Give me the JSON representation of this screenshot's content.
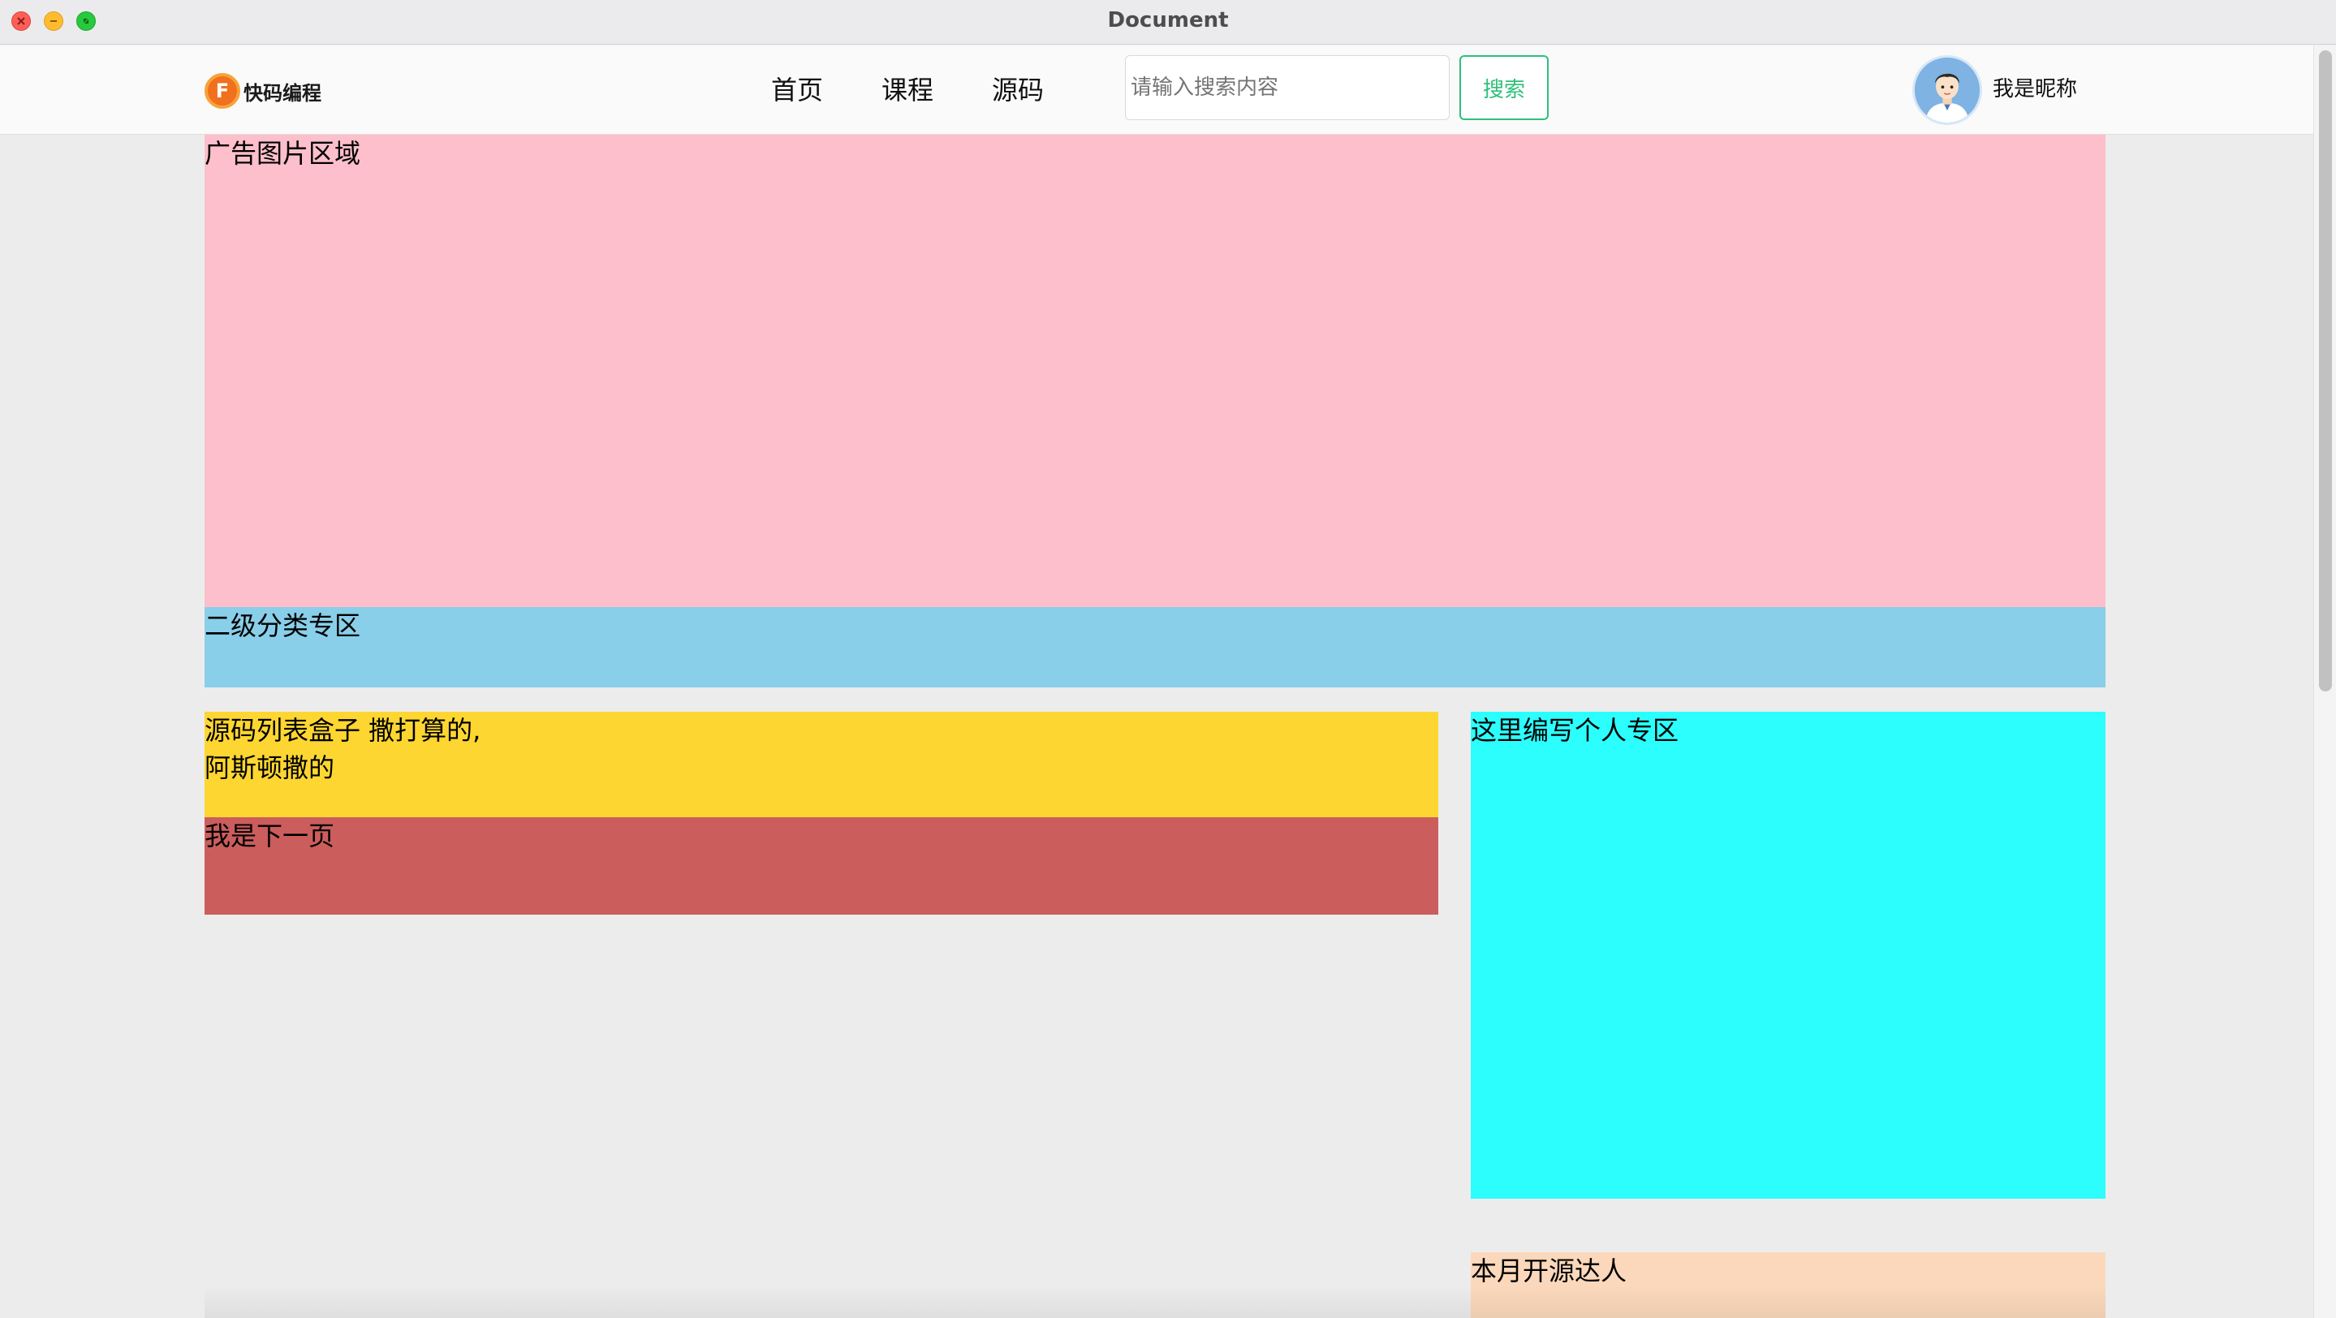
{
  "window": {
    "title": "Document",
    "controls": [
      "close-icon",
      "minimize-icon",
      "maximize-icon"
    ]
  },
  "header": {
    "logo": {
      "mark": "F",
      "text": "快码编程",
      "colors": {
        "primary": "#f0701e",
        "ring": "#f7a33a"
      }
    },
    "nav": [
      {
        "label": "首页"
      },
      {
        "label": "课程"
      },
      {
        "label": "源码"
      }
    ],
    "search": {
      "value": "",
      "placeholder": "请输入搜索内容",
      "button_label": "搜索",
      "button_color": "#2fbf7a"
    },
    "user": {
      "nickname": "我是昵称",
      "avatar_icon": "user-avatar-icon"
    }
  },
  "main": {
    "ad_area": {
      "label": "广告图片区域",
      "color": "#fdbfcb"
    },
    "subcategory": {
      "label": "二级分类专区",
      "color": "#89cfe9"
    },
    "source_list": {
      "line1": "源码列表盒子 撒打算的,",
      "line2": "阿斯顿撒的",
      "color": "#fdd631"
    },
    "pagination": {
      "label": "我是下一页",
      "color": "#cb5d5d"
    },
    "personal_zone": {
      "label": "这里编写个人专区",
      "color": "#2bfefd"
    },
    "monthly_top": {
      "label": "本月开源达人",
      "color": "#fbd8bb"
    }
  }
}
